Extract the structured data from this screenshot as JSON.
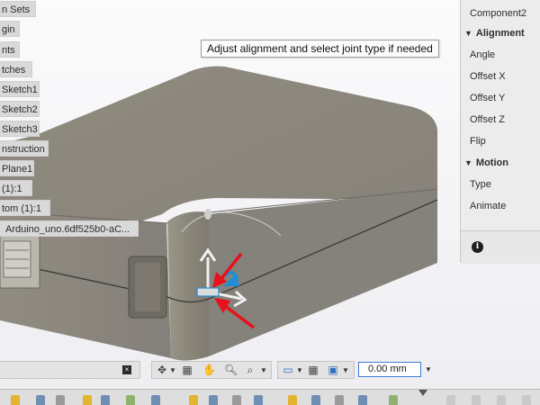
{
  "tooltip": "Adjust alignment and select joint type if needed",
  "browser": {
    "items": [
      "n Sets",
      "gin",
      "nts",
      "tches",
      "Sketch1",
      "Sketch2",
      "Sketch3",
      "nstruction",
      "Plane1",
      "(1):1",
      "tom (1):1",
      "Arduino_uno.6df525b0-aC..."
    ]
  },
  "joint_panel": {
    "component_label": "Component2",
    "alignment_header": "Alignment",
    "alignment_items": [
      "Angle",
      "Offset X",
      "Offset Y",
      "Offset Z",
      "Flip"
    ],
    "motion_header": "Motion",
    "motion_items": [
      "Type",
      "Animate"
    ],
    "info_glyph": "i"
  },
  "navbar": {
    "close_glyph": "×",
    "dimension_value": "0.00 mm"
  },
  "icons": {
    "orbit": "orbit-icon",
    "look_at": "look-at-icon",
    "pan": "pan-hand-icon",
    "zoom": "zoom-icon",
    "fit": "zoom-window-icon",
    "display": "display-settings-icon",
    "grid": "grid-icon",
    "viewports": "viewports-icon"
  },
  "colors": {
    "model_body": "#8a8679",
    "model_top": "#8f8b7e",
    "red_arrow": "#e8101a",
    "manipulator_blue": "#1f8fd6",
    "input_focus": "#3e7ad6"
  }
}
